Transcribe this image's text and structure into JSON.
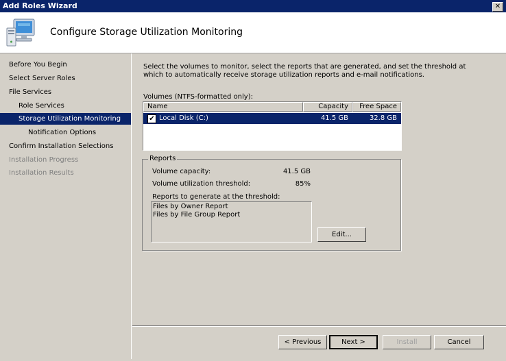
{
  "window": {
    "title": "Add Roles Wizard",
    "close_glyph": "✕"
  },
  "header": {
    "title": "Configure Storage Utilization Monitoring",
    "icon": "server-computer-icon"
  },
  "sidebar": {
    "items": [
      {
        "label": "Before You Begin",
        "state": "normal"
      },
      {
        "label": "Select Server Roles",
        "state": "normal"
      },
      {
        "label": "File Services",
        "state": "normal"
      },
      {
        "label": "Role Services",
        "state": "normal"
      },
      {
        "label": "Storage Utilization Monitoring",
        "state": "selected"
      },
      {
        "label": "Notification Options",
        "state": "normal"
      },
      {
        "label": "Confirm Installation Selections",
        "state": "normal"
      },
      {
        "label": "Installation Progress",
        "state": "disabled"
      },
      {
        "label": "Installation Results",
        "state": "disabled"
      }
    ]
  },
  "main": {
    "intro": "Select the volumes to monitor, select the reports that are generated, and set the threshold at which to automatically receive storage utilization reports and e-mail notifications.",
    "volumes_label": "Volumes (NTFS-formatted only):",
    "volumes_columns": {
      "name": "Name",
      "capacity": "Capacity",
      "free_space": "Free Space"
    },
    "volumes_rows": [
      {
        "checked": true,
        "check_glyph": "✔",
        "name": "Local Disk (C:)",
        "capacity": "41.5 GB",
        "free_space": "32.8 GB"
      }
    ],
    "reports": {
      "group_label": "Reports",
      "capacity_label": "Volume capacity:",
      "capacity_value": "41.5 GB",
      "threshold_label": "Volume utilization threshold:",
      "threshold_value": "85%",
      "list_label": "Reports to generate at the threshold:",
      "list_items": [
        "Files by Owner Report",
        "Files by File Group Report"
      ],
      "edit_button": "Edit..."
    }
  },
  "buttons": {
    "previous": "< Previous",
    "next": "Next >",
    "install": "Install",
    "cancel": "Cancel"
  },
  "colors": {
    "selection": "#0a246a",
    "face": "#d4d0c8",
    "disabled_text": "#808080"
  }
}
